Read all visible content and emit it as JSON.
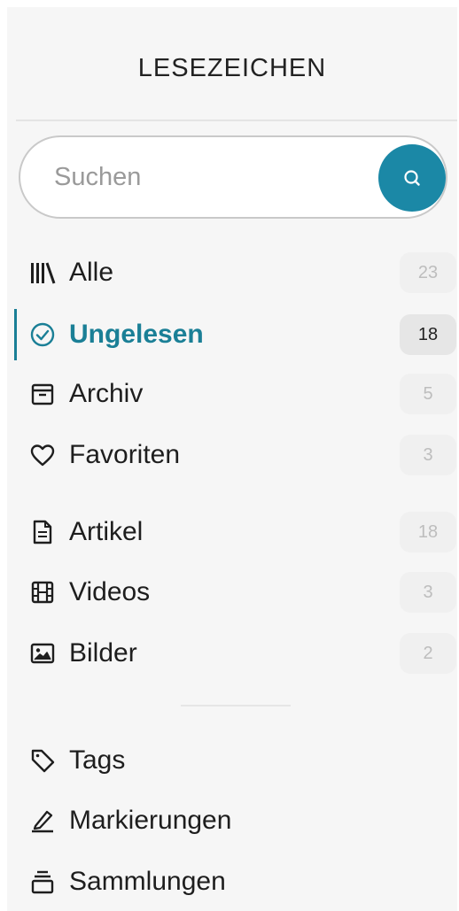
{
  "sidebar": {
    "title": "LESEZEICHEN",
    "search": {
      "placeholder": "Suchen"
    },
    "filters": [
      {
        "label": "Alle",
        "count": "23",
        "icon": "library-icon",
        "active": false
      },
      {
        "label": "Ungelesen",
        "count": "18",
        "icon": "check-circle-icon",
        "active": true
      },
      {
        "label": "Archiv",
        "count": "5",
        "icon": "archive-icon",
        "active": false
      },
      {
        "label": "Favoriten",
        "count": "3",
        "icon": "heart-icon",
        "active": false
      }
    ],
    "types": [
      {
        "label": "Artikel",
        "count": "18",
        "icon": "article-icon"
      },
      {
        "label": "Videos",
        "count": "3",
        "icon": "film-icon"
      },
      {
        "label": "Bilder",
        "count": "2",
        "icon": "image-icon"
      }
    ],
    "tools": [
      {
        "label": "Tags",
        "icon": "tag-icon"
      },
      {
        "label": "Markierungen",
        "icon": "highlighter-icon"
      },
      {
        "label": "Sammlungen",
        "icon": "collections-icon"
      }
    ],
    "colors": {
      "accent": "#1a7f96",
      "search_button": "#1b88a6"
    }
  }
}
